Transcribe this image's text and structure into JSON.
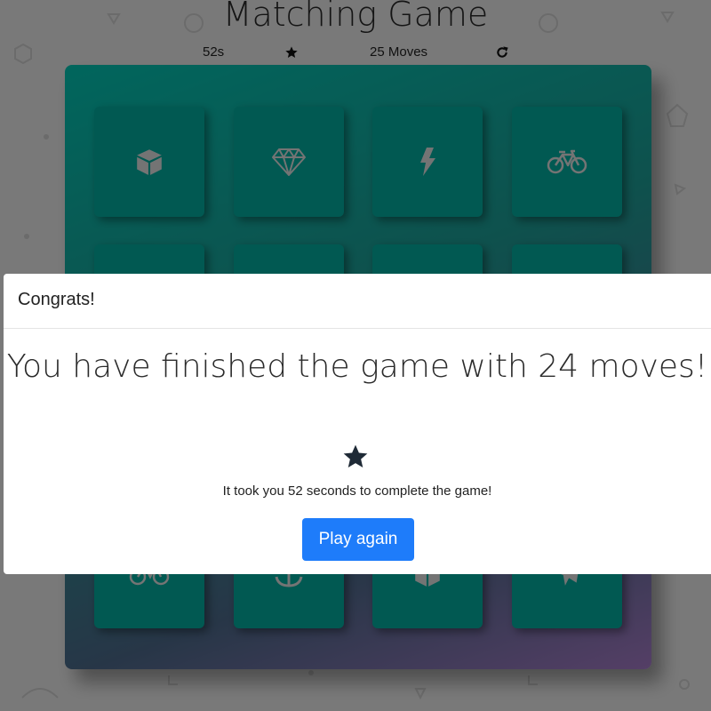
{
  "game": {
    "title": "Matching Game",
    "timer": "52s",
    "moves": "25 Moves",
    "stars": 1
  },
  "deck": {
    "cards": [
      {
        "icon": "cube-icon",
        "state": "open"
      },
      {
        "icon": "diamond-icon",
        "state": "open"
      },
      {
        "icon": "bolt-icon",
        "state": "open"
      },
      {
        "icon": "bicycle-icon",
        "state": "open"
      },
      {
        "icon": "hidden",
        "state": "closed"
      },
      {
        "icon": "hidden",
        "state": "closed"
      },
      {
        "icon": "hidden",
        "state": "closed"
      },
      {
        "icon": "hidden",
        "state": "closed"
      },
      {
        "icon": "hidden",
        "state": "closed"
      },
      {
        "icon": "hidden",
        "state": "closed"
      },
      {
        "icon": "hidden",
        "state": "closed"
      },
      {
        "icon": "hidden",
        "state": "closed"
      },
      {
        "icon": "bicycle-icon",
        "state": "open"
      },
      {
        "icon": "anchor-icon",
        "state": "open"
      },
      {
        "icon": "cube-icon",
        "state": "open"
      },
      {
        "icon": "paper-plane-icon",
        "state": "open"
      }
    ]
  },
  "modal": {
    "header": "Congrats!",
    "message": "You have finished the game with 24 moves!",
    "time_text": "It took you 52 seconds to complete the game!",
    "button_label": "Play again",
    "stars": 1
  },
  "colors": {
    "card": "#02b3a4",
    "icon": "#e8e8e8",
    "button": "#1e7cfa",
    "overlay": "rgba(0,0,0,0.5)"
  }
}
